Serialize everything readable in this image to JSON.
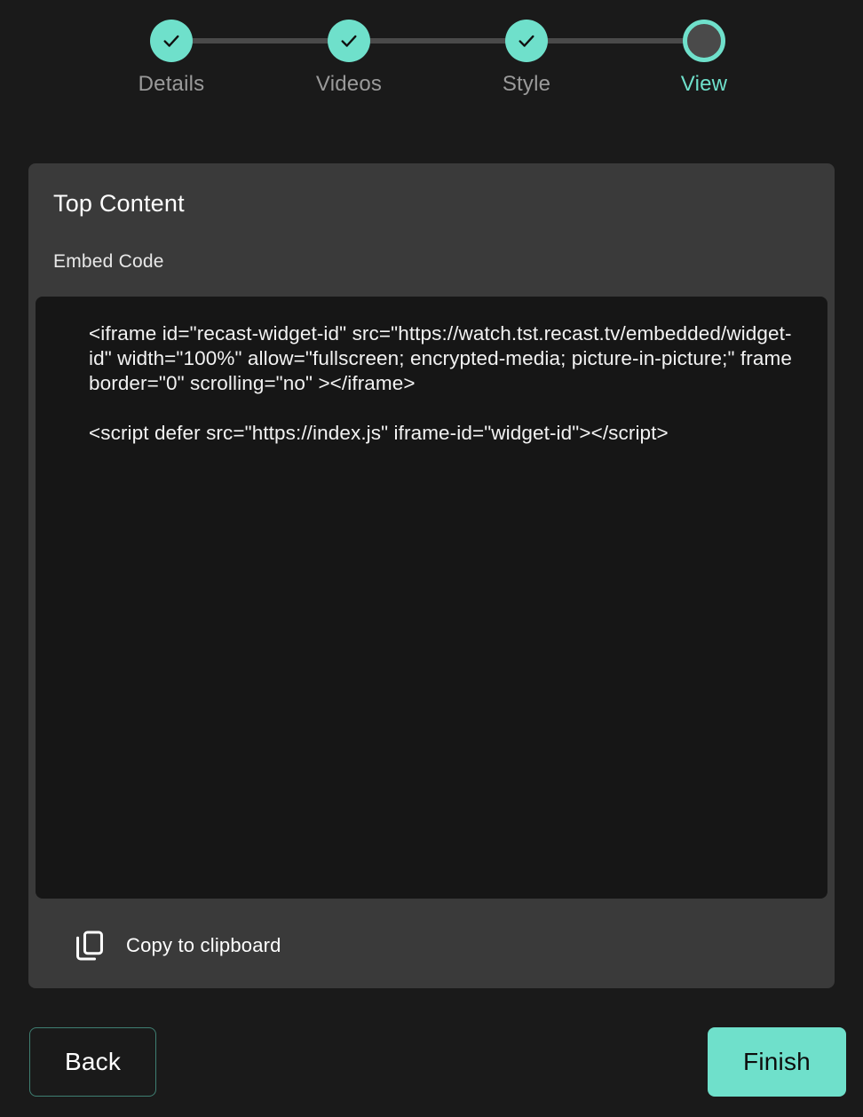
{
  "colors": {
    "page_background": "#1a1a1a",
    "card_background": "#3a3a3a",
    "code_background": "#161616",
    "accent": "#6fe0cb",
    "track": "#4a4a4a",
    "muted_text": "#9a9a9a",
    "back_border": "#3f7f72"
  },
  "stepper": {
    "steps": [
      {
        "label": "Details",
        "state": "done",
        "icon": "check-icon"
      },
      {
        "label": "Videos",
        "state": "done",
        "icon": "check-icon"
      },
      {
        "label": "Style",
        "state": "done",
        "icon": "check-icon"
      },
      {
        "label": "View",
        "state": "current",
        "icon": "circle-icon"
      }
    ]
  },
  "card": {
    "title": "Top Content",
    "subtitle": "Embed Code",
    "embed_code": {
      "iframe_line": "<iframe id=\"recast-widget-id\" src=\"https://watch.tst.recast.tv/embedded/widget-id\" width=\"100%\" allow=\"fullscreen; encrypted-media; picture-in-picture;\" frameborder=\"0\" scrolling=\"no\" ></iframe>",
      "script_line": "<script defer src=\"https://index.js\" iframe-id=\"widget-id\"></script>"
    },
    "copy": {
      "label": "Copy to clipboard",
      "icon": "copy-icon"
    }
  },
  "footer": {
    "back_label": "Back",
    "finish_label": "Finish"
  }
}
